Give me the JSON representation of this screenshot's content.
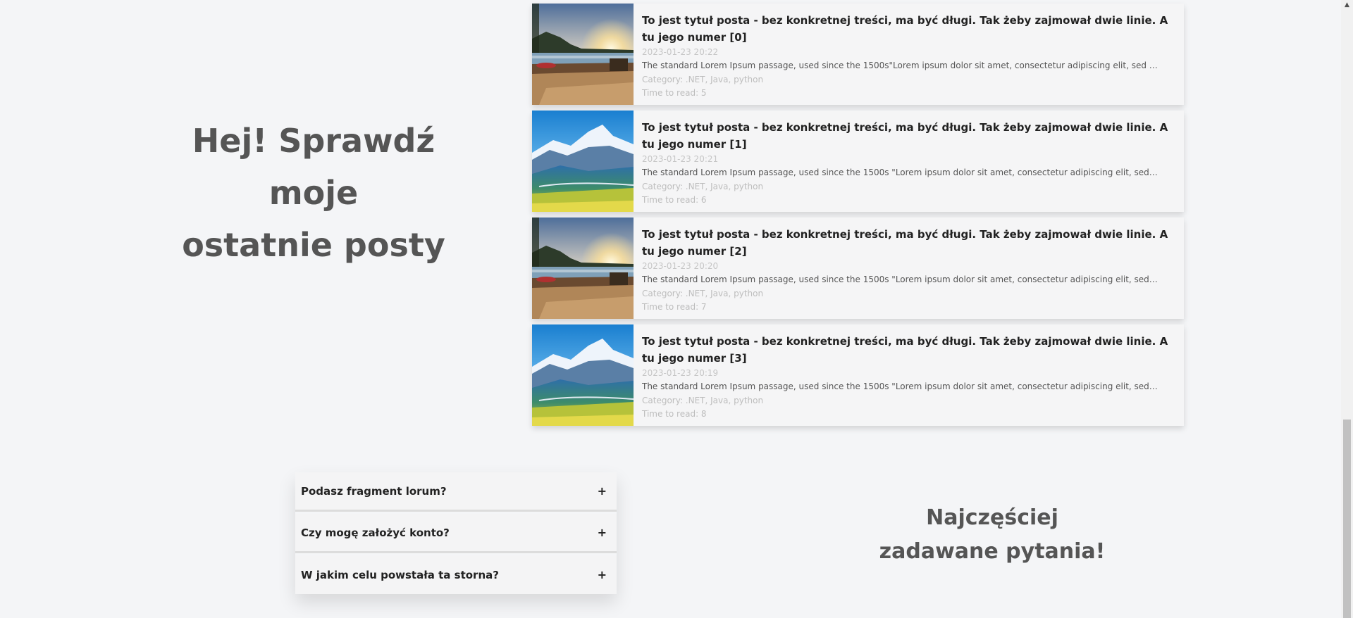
{
  "hero": {
    "line1": "Hej! Sprawdź moje",
    "line2": "ostatnie posty"
  },
  "posts": [
    {
      "title": "To jest tytuł posta - bez konkretnej treści, ma być długi. Tak żeby zajmował dwie linie. A tu jego numer [0]",
      "date": "2023-01-23 20:22",
      "excerpt": "The standard Lorem Ipsum passage, used since the 1500s\"Lorem ipsum dolor sit amet, consectetur adipiscing elit, sed do...",
      "category": "Category: .NET, Java, python",
      "time_to_read": "Time to read: 5",
      "image": "sunset-pool-image"
    },
    {
      "title": "To jest tytuł posta - bez konkretnej treści, ma być długi. Tak żeby zajmował dwie linie. A tu jego numer [1]",
      "date": "2023-01-23 20:21",
      "excerpt": "The standard Lorem Ipsum passage, used since the 1500s \"Lorem ipsum dolor sit amet, consectetur adipiscing elit, sed d...",
      "category": "Category: .NET, Java, python",
      "time_to_read": "Time to read: 6",
      "image": "mountain-valley-image"
    },
    {
      "title": "To jest tytuł posta - bez konkretnej treści, ma być długi. Tak żeby zajmował dwie linie. A tu jego numer [2]",
      "date": "2023-01-23 20:20",
      "excerpt": "The standard Lorem Ipsum passage, used since the 1500s \"Lorem ipsum dolor sit amet, consectetur adipiscing elit, sed d...",
      "category": "Category: .NET, Java, python",
      "time_to_read": "Time to read: 7",
      "image": "sunset-pool-image"
    },
    {
      "title": "To jest tytuł posta - bez konkretnej treści, ma być długi. Tak żeby zajmował dwie linie. A tu jego numer [3]",
      "date": "2023-01-23 20:19",
      "excerpt": "The standard Lorem Ipsum passage, used since the 1500s \"Lorem ipsum dolor sit amet, consectetur adipiscing elit, sed d...",
      "category": "Category: .NET, Java, python",
      "time_to_read": "Time to read: 8",
      "image": "mountain-valley-image"
    }
  ],
  "faq": {
    "items": [
      {
        "question": "Podasz fragment lorum?",
        "toggle": "+"
      },
      {
        "question": "Czy mogę założyć konto?",
        "toggle": "+"
      },
      {
        "question": "W jakim celu powstała ta storna?",
        "toggle": "+"
      }
    ],
    "heading_line1": "Najczęściej",
    "heading_line2": "zadawane pytania!"
  },
  "scrollbar": {
    "up_arrow": "▲"
  },
  "colors": {
    "background": "#f4f5f7",
    "heading": "#555555",
    "muted": "#c6c6c6"
  }
}
